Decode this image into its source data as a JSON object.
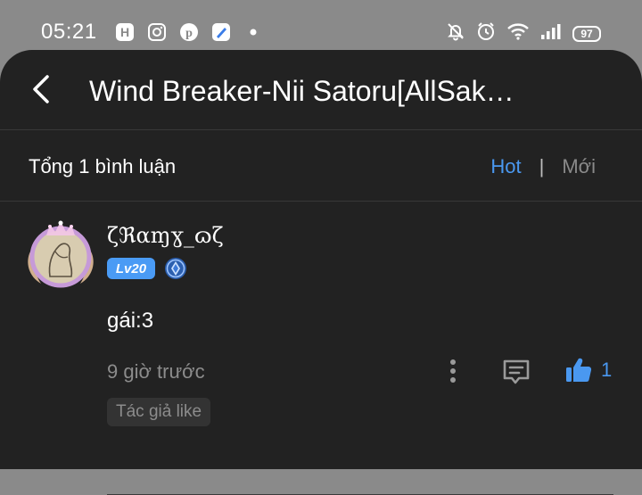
{
  "status_bar": {
    "time": "05:21",
    "battery": "97",
    "app_icons": [
      "h-app-icon",
      "instagram-icon",
      "pinterest-icon",
      "blue-app-icon",
      "dot-icon"
    ],
    "system_icons": [
      "mute-bell-icon",
      "alarm-icon",
      "wifi-icon",
      "signal-icon",
      "battery-icon"
    ]
  },
  "header": {
    "title": "Wind Breaker-Nii Satoru[AllSak…"
  },
  "subheader": {
    "total": "Tổng 1 bình luận",
    "sort_hot": "Hot",
    "separator": "|",
    "sort_new": "Mới"
  },
  "comment": {
    "username": "ζℜαɱɣ_ɷζ",
    "level": "Lv20",
    "content": "gái:3",
    "time": "9 giờ trước",
    "like_count": "1",
    "author_like": "Tác giả like"
  },
  "colors": {
    "accent": "#4a98f0",
    "background": "#222222",
    "muted": "#8c8c8c"
  }
}
